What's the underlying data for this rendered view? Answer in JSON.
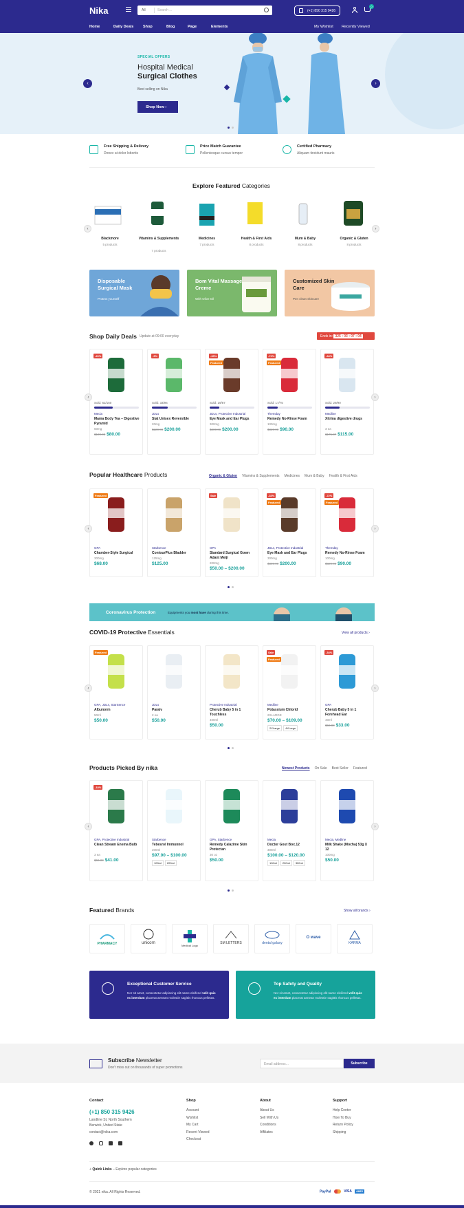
{
  "header": {
    "logo": "Nika",
    "search_cat": "All",
    "search_placeholder": "Search ...",
    "phone": "(+1) 850 315 9426",
    "cart_count": "0"
  },
  "nav": {
    "items": [
      "Home",
      "Daily Deals",
      "Shop",
      "Blog",
      "Page",
      "Elements"
    ],
    "right": [
      "My Wishlist",
      "Recently Viewed"
    ]
  },
  "hero": {
    "tag": "SPECIAL OFFERS",
    "title1": "Hospital Medical",
    "title2": "Surgical Clothes",
    "sub": "Best selling on Nika",
    "button": "Shop Now"
  },
  "features": [
    {
      "title": "Free Shipping & Delivery",
      "sub": "Donec at dolor lobortis"
    },
    {
      "title": "Price Match Guarantee",
      "sub": "Pellentesque cursus tempor"
    },
    {
      "title": "Certified Pharmacy",
      "sub": "Aliquam tincidunt mauris"
    }
  ],
  "categories": {
    "heading_a": "Explore Featured",
    "heading_b": "Categories",
    "items": [
      {
        "name": "Blackmore",
        "count": "5 products"
      },
      {
        "name": "Vitamins & Supplements",
        "count": "7 products"
      },
      {
        "name": "Medicines",
        "count": "7 products"
      },
      {
        "name": "Health & First Aids",
        "count": "8 products"
      },
      {
        "name": "Mum & Baby",
        "count": "8 products"
      },
      {
        "name": "Organic & Gluten",
        "count": "8 products"
      }
    ]
  },
  "banners": [
    {
      "title": "Disposable Surgical Mask",
      "sub": "Protect yourself",
      "color": "#6fa6d8"
    },
    {
      "title": "Bom Vital Massage Creme",
      "sub": "With Olive Oil",
      "color": "#7bb86c"
    },
    {
      "title": "Customized Skin Care",
      "sub": "Pen clean skincare",
      "color": "#f2c7a4"
    }
  ],
  "deals": {
    "heading_a": "Shop",
    "heading_b": "Daily Deals",
    "sub": "Update at 09:00 everyday",
    "ends_label": "Ends in:",
    "timer": "325 : 03 : 07 : 04",
    "items": [
      {
        "badge": "-20%",
        "sold": "Sold: 62/150",
        "fill": 0.41,
        "vendor": "Mecia",
        "name": "Mama Body Tea – Digestive Pyramid",
        "unit": "60mg",
        "old": "$100.00",
        "price": "$80.00"
      },
      {
        "badge": "-9%",
        "sold": "Sold: 33/94",
        "fill": 0.35,
        "vendor": "JDLs",
        "name": "Stat Unisex Reversible",
        "unit": "20mg",
        "old": "$220.00",
        "price": "$200.00"
      },
      {
        "badge": "-33%",
        "badge2": "Featured",
        "sold": "Sold: 19/87",
        "fill": 0.22,
        "vendor": "JDLs, Protective Industrial",
        "name": "Eye Mask and Ear Plugs",
        "unit": "300mg",
        "old": "$300.00",
        "price": "$200.00"
      },
      {
        "badge": "-72%",
        "badge2": "Featured",
        "sold": "Sold: 17/75",
        "fill": 0.23,
        "vendor": "Themday",
        "name": "Remedy No-Rinse Foam",
        "unit": "100mg",
        "old": "$320.00",
        "price": "$90.00"
      },
      {
        "badge": "-34%",
        "sold": "Sold: 29/90",
        "fill": 0.32,
        "vendor": "Medline",
        "name": "Xitrina digestive drugs",
        "unit": "3 ea",
        "old": "$175.07",
        "price": "$115.00"
      }
    ]
  },
  "popular": {
    "heading_a": "Popular Healthcare",
    "heading_b": "Products",
    "tabs": [
      "Organic & Gluten",
      "Vitamins & Supplements",
      "Medicines",
      "Mum & Baby",
      "Health & First Aids"
    ],
    "items": [
      {
        "badge": "Featured",
        "vendor": "GPA",
        "name": "Chamber-Style Surgical",
        "unit": "300mg",
        "old": "",
        "price": "$68.00"
      },
      {
        "badge": "",
        "vendor": "Starbence",
        "name": "ContourPlus Bladder",
        "unit": "125mg",
        "old": "",
        "price": "$125.00"
      },
      {
        "badge": "Sale",
        "vendor": "GPA",
        "name": "Standard Surgical Gown Adant Meiji",
        "unit": "200mg",
        "old": "",
        "price": "$50.00 – $200.00"
      },
      {
        "badge": "-33%",
        "badge2": "Featured",
        "vendor": "JDLs, Protective Industrial",
        "name": "Eye Mask and Ear Plugs",
        "unit": "300mg",
        "old": "$300.00",
        "price": "$200.00"
      },
      {
        "badge": "-72%",
        "badge2": "Featured",
        "vendor": "Themday",
        "name": "Remedy No-Rinse Foam",
        "unit": "100mg",
        "old": "$320.00",
        "price": "$90.00"
      }
    ]
  },
  "corona": {
    "title": "Coronavirus Protection",
    "text_a": "Equipments you",
    "text_b": "most have",
    "text_c": "during this time."
  },
  "covid": {
    "heading_a": "COVID-19 Protective",
    "heading_b": "Essentials",
    "link": "View all products",
    "items": [
      {
        "badge": "Featured",
        "vendor": "GPA, JDLs, StarSence",
        "name": "Albunorm",
        "unit": "50ml",
        "old": "",
        "price": "$50.00",
        "chips": []
      },
      {
        "badge": "",
        "vendor": "JDLs",
        "name": "Paraiv",
        "unit": "2 ea",
        "old": "",
        "price": "$50.00",
        "chips": []
      },
      {
        "badge": "",
        "vendor": "Protective Industrial",
        "name": "Cherub Baby 5 in 1 Touchless",
        "unit": "400ml",
        "old": "",
        "price": "$50.00",
        "chips": []
      },
      {
        "badge": "Sale",
        "badge2": "Featured",
        "vendor": "Medline",
        "name": "Potassium Chlorid",
        "unit": "2XLARGE",
        "old": "",
        "price": "$70.00 – $109.00",
        "chips": [
          "2XLarge",
          "4XLarge"
        ]
      },
      {
        "badge": "-34%",
        "vendor": "GPA",
        "name": "Cherub Baby 5 in 1 Forehead Ear",
        "unit": "40ml",
        "old": "$50.00",
        "price": "$33.00",
        "chips": []
      }
    ]
  },
  "picked": {
    "heading_a": "Products Picked By",
    "heading_b": "nika",
    "tabs": [
      "Newest Products",
      "On Sale",
      "Best Seller",
      "Featured"
    ],
    "items": [
      {
        "badge": "-18%",
        "vendor": "GPA, Protective Industrial",
        "name": "Clean Stream Enema Bulb",
        "unit": "3 ea",
        "old": "$50.00",
        "price": "$41.00",
        "chips": []
      },
      {
        "badge": "",
        "vendor": "Starbence",
        "name": "Tebesrol Immunnol",
        "unit": "200ml",
        "old": "",
        "price": "$97.00 – $100.00",
        "chips": [
          "100ml",
          "200ml"
        ]
      },
      {
        "badge": "",
        "vendor": "GPA, Starbence",
        "name": "Remedy Calazime Skin Protectan",
        "unit": "30 oz",
        "old": "",
        "price": "$50.00",
        "chips": []
      },
      {
        "badge": "",
        "vendor": "Mecia",
        "name": "Doctor Gout Box.12",
        "unit": "300ml",
        "old": "",
        "price": "$100.00 – $120.00",
        "chips": [
          "100ml",
          "200ml",
          "300ml"
        ]
      },
      {
        "badge": "",
        "vendor": "Mecia, Medline",
        "name": "Milk Shake (Mocha) 53g X 12",
        "unit": "100mg",
        "old": "",
        "price": "$50.00",
        "chips": []
      }
    ]
  },
  "brands": {
    "heading_a": "Featured",
    "heading_b": "Brands",
    "link": "Show all brands",
    "items": [
      "PHARMACY",
      "unicorn",
      "Medical Logo",
      "SM LETTERS",
      "dental galaxy",
      "O wave",
      "KARMA"
    ]
  },
  "services": [
    {
      "title": "Exceptional Customer Service",
      "desc_a": "Nor sit amet, consectetur adipiscing elit name eleifend",
      "desc_b": "velit quis ex interdum",
      "desc_c": "placerat aenean molestie sagittis rhoncus pelletas.",
      "color": "#2c2a8e"
    },
    {
      "title": "Top Safety and Quality",
      "desc_a": "Nor sit amet, consectetur adipiscing elit name eleifend",
      "desc_b": "velit quis ex interdum",
      "desc_c": "placerat aenean molestie sagittis rhoncus pelletas.",
      "color": "#16a39b"
    }
  ],
  "newsletter": {
    "title_a": "Subscribe",
    "title_b": "Newsletter",
    "sub": "Don't miss out on thousands of super promotions",
    "placeholder": "Email address...",
    "button": "Subscribe"
  },
  "footer": {
    "contact": {
      "head": "Contact",
      "phone": "(+1) 850 315 9426",
      "addr1": "Landline St, North Southern",
      "addr2": "Berwick, United State",
      "email": "contact@nika.com"
    },
    "shop": {
      "head": "Shop",
      "links": [
        "Account",
        "Wishlist",
        "My Cart",
        "Recent Viewed",
        "Checkout"
      ]
    },
    "about": {
      "head": "About",
      "links": [
        "About Us",
        "Sell With Us",
        "Conditions",
        "Affiliates"
      ]
    },
    "support": {
      "head": "Support",
      "links": [
        "Help Center",
        "How To Buy",
        "Return Policy",
        "Shipping"
      ]
    },
    "quick_a": "Quick Links",
    "quick_b": "– Explore popular categories",
    "copy": "© 2021 nika. All Rights Reserved.",
    "payments": [
      "PayPal",
      "MC",
      "VISA",
      "AMEX"
    ]
  }
}
